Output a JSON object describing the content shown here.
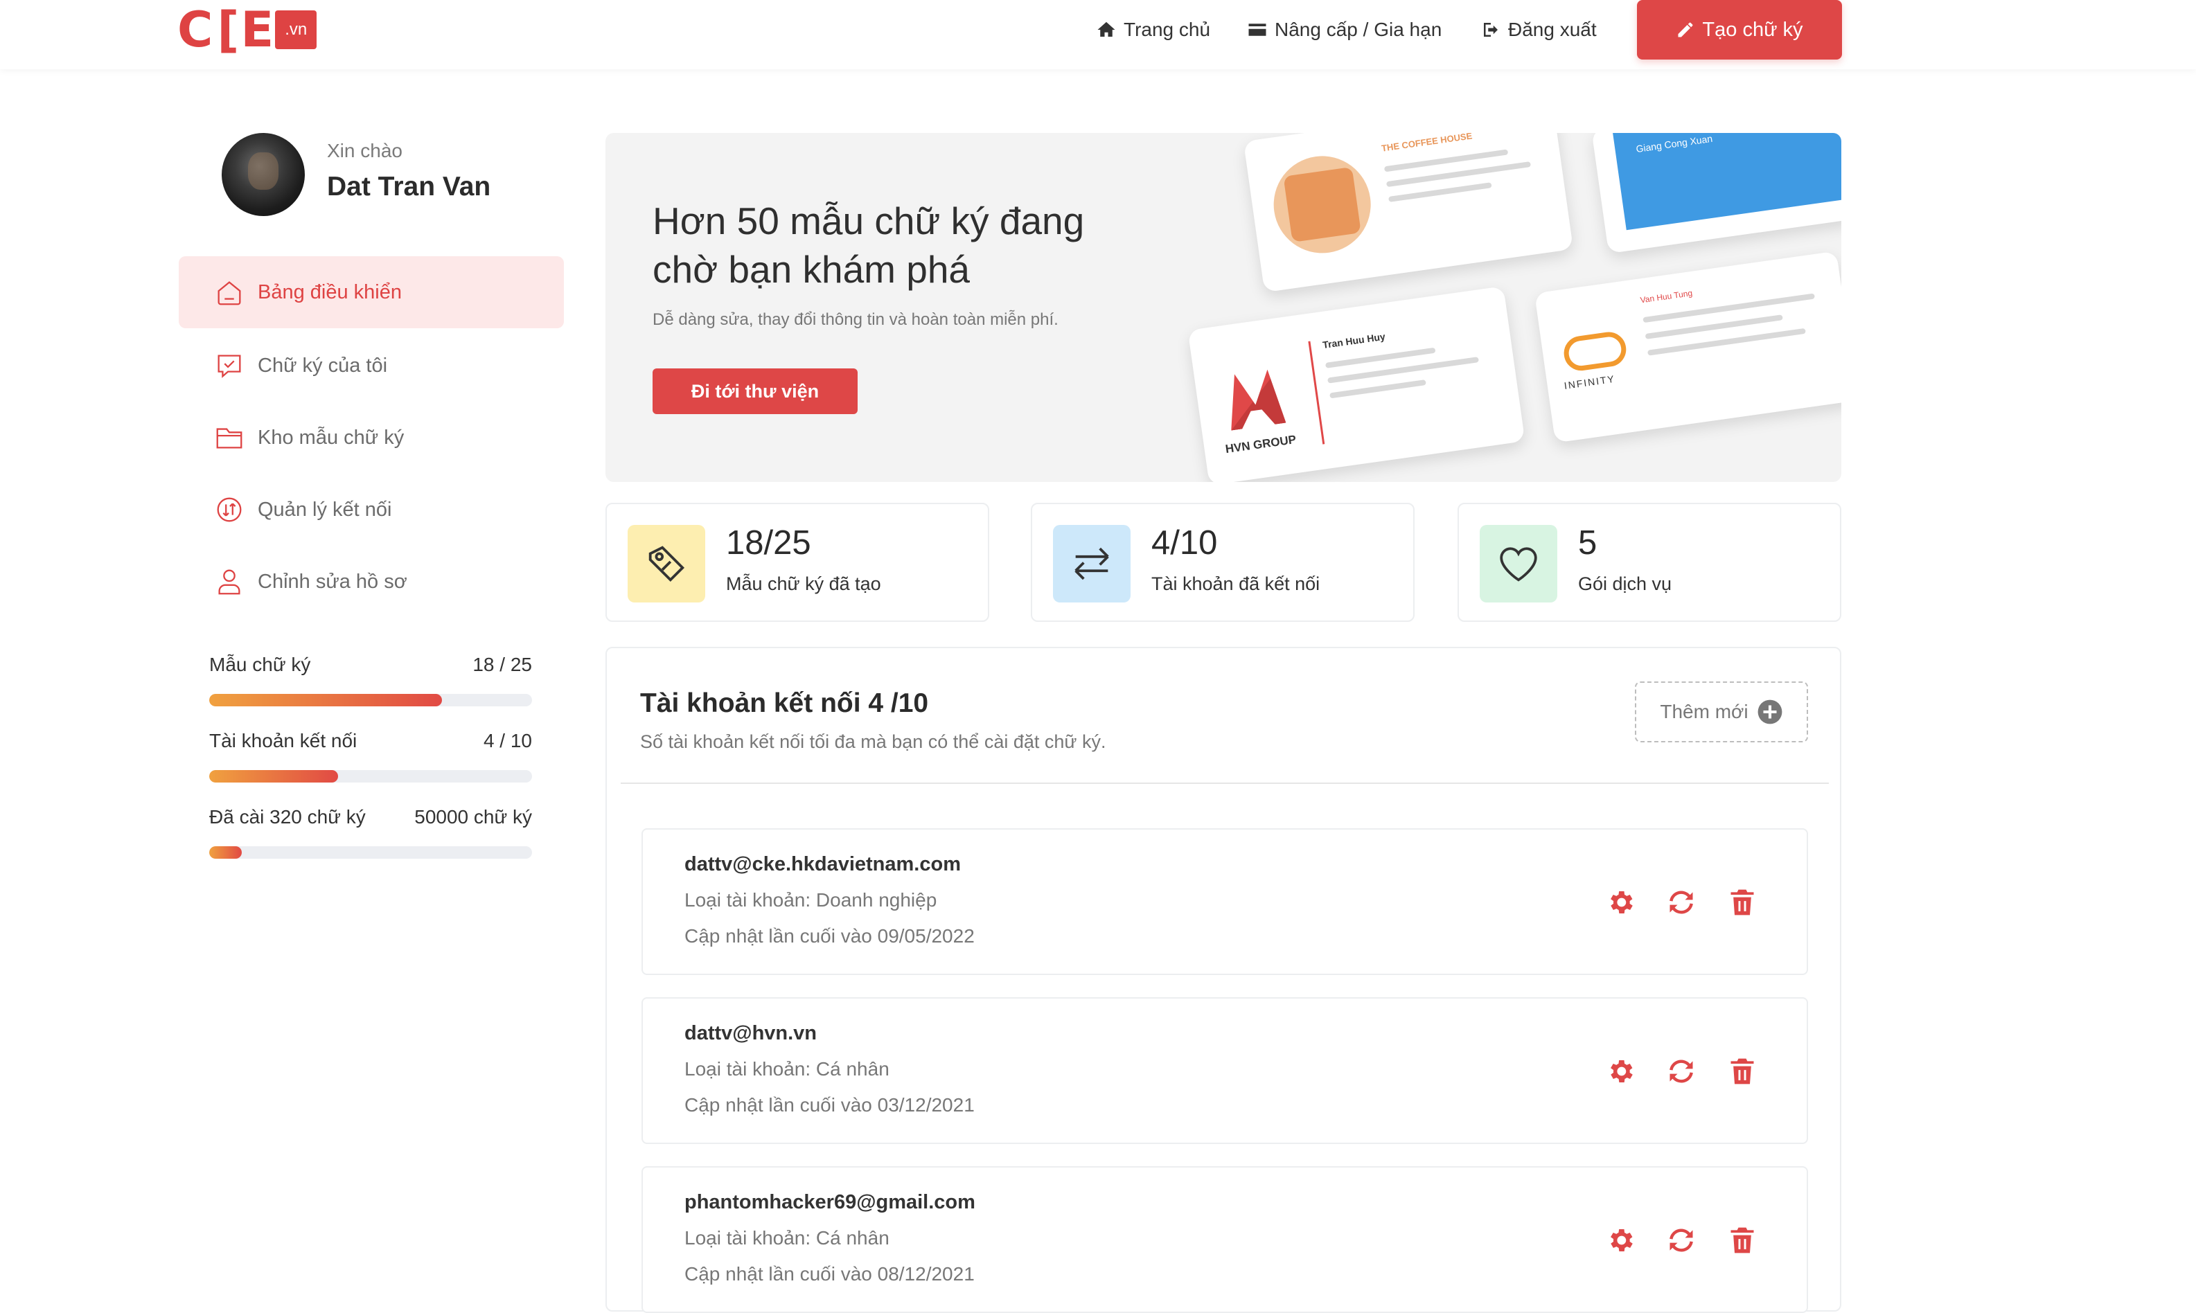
{
  "header": {
    "logo": {
      "text": "CKE",
      "tag": ".vn"
    },
    "nav": {
      "home": "Trang chủ",
      "upgrade": "Nâng cấp / Gia hạn",
      "logout": "Đăng xuất"
    },
    "create_button": "Tạo chữ ký"
  },
  "user": {
    "greeting": "Xin chào",
    "name": "Dat Tran Van"
  },
  "sidebar": {
    "items": [
      {
        "label": "Bảng điều khiển",
        "icon": "home-icon",
        "active": true
      },
      {
        "label": "Chữ ký của tôi",
        "icon": "chat-signature-icon",
        "active": false
      },
      {
        "label": "Kho mẫu chữ ký",
        "icon": "folder-icon",
        "active": false
      },
      {
        "label": "Quản lý kết nối",
        "icon": "connection-icon",
        "active": false
      },
      {
        "label": "Chỉnh sửa hồ sơ",
        "icon": "user-icon",
        "active": false
      }
    ],
    "stats": [
      {
        "label": "Mẫu chữ ký",
        "value": "18 / 25",
        "progress": 0.72
      },
      {
        "label": "Tài khoản kết nối",
        "value": "4 / 10",
        "progress": 0.4
      },
      {
        "label": "Đã cài 320 chữ ký",
        "value": "50000 chữ ký",
        "progress": 0.1
      }
    ]
  },
  "banner": {
    "title": "Hơn 50 mẫu chữ ký đang chờ bạn khám phá",
    "subtitle": "Dễ dàng sửa, thay đổi thông tin và hoàn toàn miễn phí.",
    "button": "Đi tới thư viện",
    "cards": {
      "coffee": "THE COFFEE HOUSE",
      "blue_name": "Giang Cong Xuan",
      "hvn_name": "Tran Huu Huy",
      "hvn_brand": "HVN GROUP",
      "infinity_name": "Van Huu Tung",
      "infinity_brand": "INFINITY"
    }
  },
  "stat_cards": [
    {
      "value": "18/25",
      "caption": "Mẫu chữ ký đã tạo",
      "icon": "tag-icon",
      "color": "#fdeeb0"
    },
    {
      "value": "4/10",
      "caption": "Tài khoản đã kết nối",
      "icon": "swap-arrows-icon",
      "color": "#cde8fa"
    },
    {
      "value": "5",
      "caption": "Gói dịch vụ",
      "icon": "heart-icon",
      "color": "#d8f4e2"
    }
  ],
  "connections": {
    "title": "Tài khoản kết nối 4 /10",
    "subtitle": "Số tài khoản kết nối tối đa mà bạn có thể cài đặt chữ ký.",
    "add_button": "Thêm mới",
    "accounts": [
      {
        "email": "dattv@cke.hkdavietnam.com",
        "type": "Loại tài khoản: Doanh nghiệp",
        "updated": "Cập nhật lần cuối vào 09/05/2022"
      },
      {
        "email": "dattv@hvn.vn",
        "type": "Loại tài khoản: Cá nhân",
        "updated": "Cập nhật lần cuối vào 03/12/2021"
      },
      {
        "email": "phantomhacker69@gmail.com",
        "type": "Loại tài khoản: Cá nhân",
        "updated": "Cập nhật lần cuối vào 08/12/2021"
      }
    ]
  },
  "colors": {
    "accent": "#de4747",
    "active_bg": "#fde8e8"
  }
}
